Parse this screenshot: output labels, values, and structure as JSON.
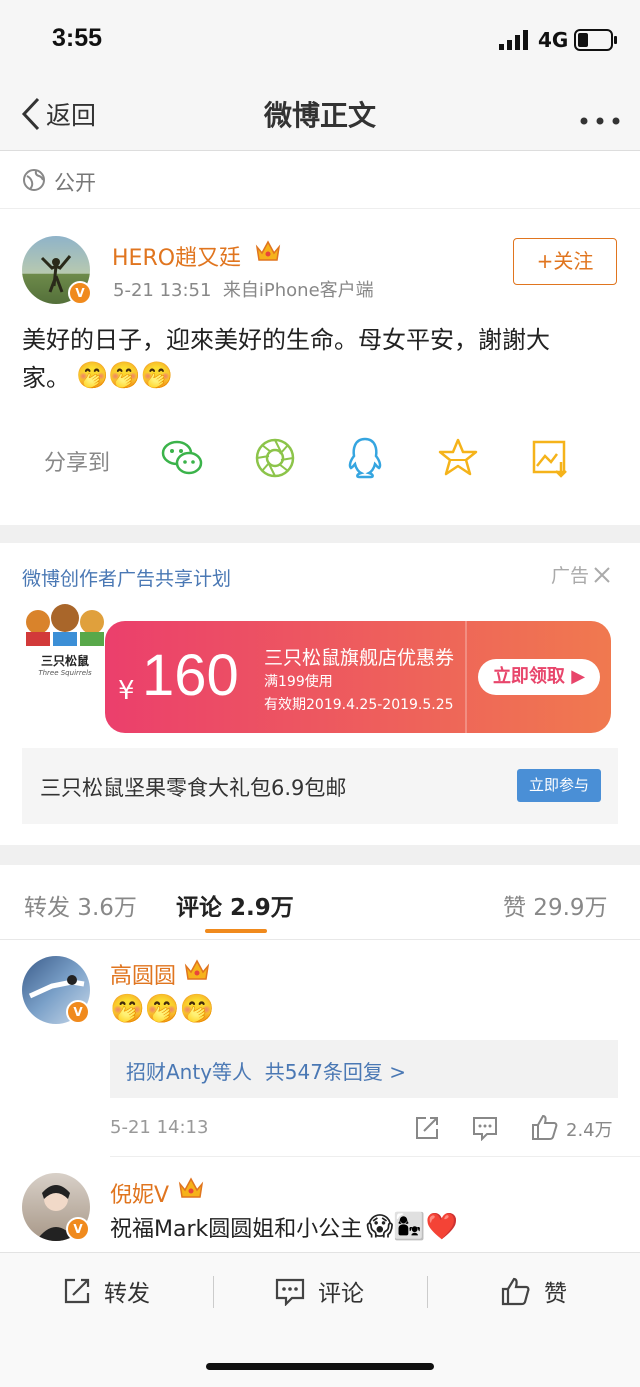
{
  "status_bar": {
    "time": "3:55",
    "network": "4G"
  },
  "nav": {
    "back_label": "返回",
    "title": "微博正文"
  },
  "visibility": {
    "label": "公开"
  },
  "post": {
    "author": "HERO趙又廷",
    "meta": "5-21 13:51  来自iPhone客户端",
    "follow_label": "+关注",
    "text_line1": "美好的日子，迎來美好的生命。母女平安，謝謝大",
    "text_line2": "家。",
    "emoji": "🤭🤭🤭",
    "share_label": "分享到"
  },
  "ad": {
    "plan_label": "微博创作者广告共享计划",
    "ad_tag": "广告",
    "brand_text": "三只松鼠",
    "brand_sub": "Three Squirrels",
    "currency": "¥",
    "amount": "160",
    "coupon_title": "三只松鼠旗舰店优惠券",
    "coupon_cond": "满199使用",
    "coupon_valid": "有效期2019.4.25-2019.5.25",
    "claim_label": "立即领取",
    "promo_text": "三只松鼠坚果零食大礼包6.9包邮",
    "join_label": "立即参与"
  },
  "tabs": {
    "repost": "转发 3.6万",
    "comment": "评论 2.9万",
    "like": "赞 29.9万"
  },
  "comments": [
    {
      "name": "高圆圆",
      "emoji": "🤭🤭🤭",
      "reply_summary": "招财Anty等人  共547条回复 >",
      "time": "5-21 14:13",
      "likes": "2.4万"
    },
    {
      "name": "倪妮V",
      "text": "祝福Mark圆圆姐和小公主",
      "emoji": "😱👩‍👧❤️"
    }
  ],
  "bottom_bar": {
    "repost": "转发",
    "comment": "评论",
    "like": "赞"
  },
  "colors": {
    "accent": "#e0751f",
    "link": "#4a78b4",
    "ad_gradient_start": "#eb3f6c",
    "ad_gradient_end": "#f0794f"
  }
}
